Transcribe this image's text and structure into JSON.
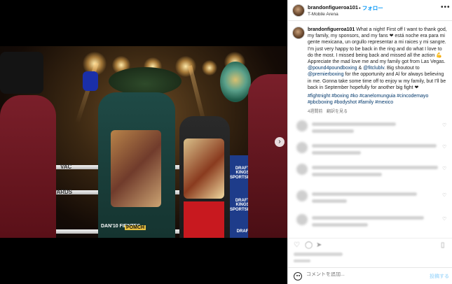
{
  "header": {
    "username": "brandonfigueroa101",
    "separator": "•",
    "follow_label": "フォロー",
    "location": "T-Mobile Arena",
    "more_icon": "more-horizontal-icon"
  },
  "caption": {
    "username": "brandonfigueroa101",
    "text_1": "What a night! First off I want to thank god, my family, my sponsors, and my fans ❤ está noche era para mi gente mexicana, un orgullo representar a mi raices y mi sangre. I'm just very happy to be back in the ring and do what I love to do the most. I missed being back and missed all the action 💪 Appreciate the mad love me and my family got from Las Vegas.",
    "mention_1": "@pound4poundboxing",
    "and_1": " & ",
    "mention_2": "@fitclublv",
    "text_2": ". Big shoutout to ",
    "mention_3": "@premierboxing",
    "text_3": " for the opportunity and Al for always believing in me. Gonna take some time off to enjoy w my family, but I'll be back in September hopefully for another big fight ❤",
    "hashtags": "#fightnight #boxing #ko #canelomunguia #cincodemayo #pbcboxing #bodyshot #family #mexico",
    "time_ago": "4週間前",
    "translate_label": "翻訳を見る"
  },
  "photo": {
    "rope_text_1": "VAC",
    "rope_text_2": "EWARDS",
    "rope_text_3": "MC",
    "ad_1": "DRAFT KINGS SPORTSBOOK",
    "ad_2": "DRAFT KINGS SPORTSBOOK",
    "ad_3": "DRAF",
    "trunks_1": "DAN'10 FIENTES",
    "trunks_2": "POMCH",
    "next_icon": "chevron-right-icon",
    "next_glyph": "›"
  },
  "comment_bar": {
    "placeholder": "コメントを追加...",
    "post_label": "投稿する",
    "emoji_icon": "emoji-icon"
  },
  "colors": {
    "link": "#00376b",
    "follow": "#0095f6",
    "ad_blue": "#1e3c8a"
  }
}
